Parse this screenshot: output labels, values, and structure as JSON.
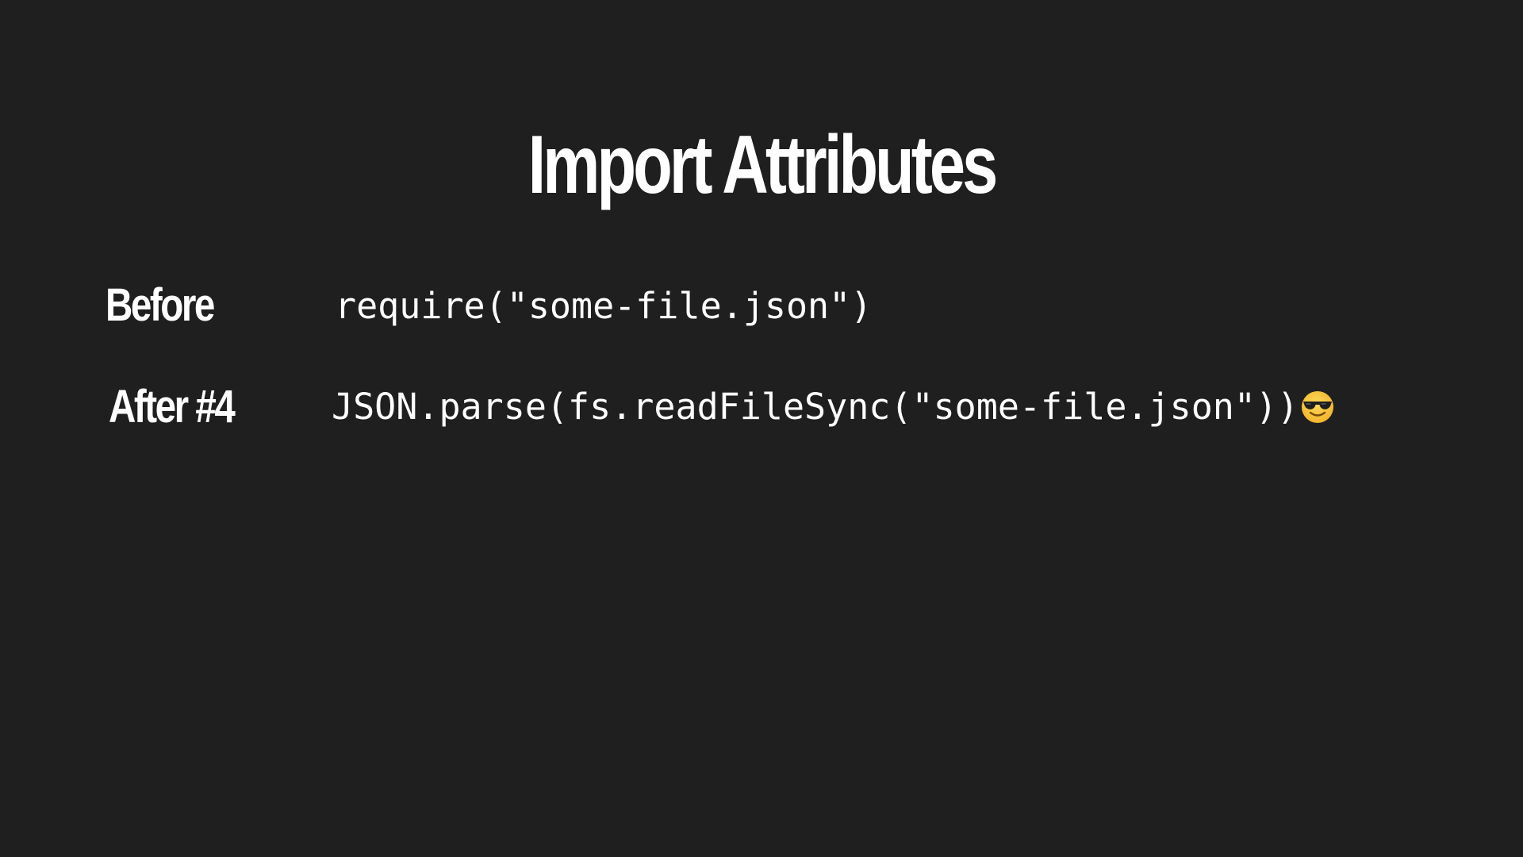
{
  "slide": {
    "title": "Import Attributes",
    "rows": [
      {
        "label": "Before",
        "code": "require(\"some-file.json\")"
      },
      {
        "label": "After #4",
        "code": "JSON.parse(fs.readFileSync(\"some-file.json\"))",
        "emoji_icon": "smiling-face-with-sunglasses-icon"
      }
    ]
  },
  "colors": {
    "background": "#1f1f1f",
    "text": "#ffffff",
    "emoji_face": "#f7c23c",
    "emoji_glasses": "#1e1e1e"
  }
}
